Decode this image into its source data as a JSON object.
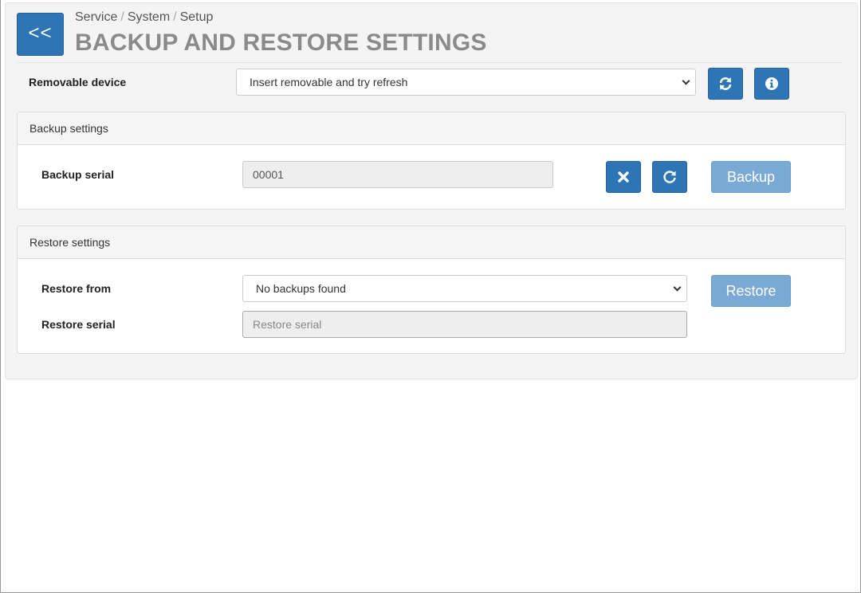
{
  "header": {
    "back_label": "<<",
    "breadcrumb": [
      "Service",
      "System",
      "Setup"
    ],
    "breadcrumb_sep": "/",
    "title": "BACKUP AND RESTORE SETTINGS"
  },
  "device": {
    "label": "Removable device",
    "selected": "Insert removable and try refresh",
    "refresh_icon": "refresh-icon",
    "info_icon": "info-icon"
  },
  "backup": {
    "heading": "Backup settings",
    "serial_label": "Backup serial",
    "serial_value": "00001",
    "clear_icon": "close-icon",
    "reset_icon": "reload-icon",
    "button_label": "Backup"
  },
  "restore": {
    "heading": "Restore settings",
    "from_label": "Restore from",
    "from_selected": "No backups found",
    "serial_label": "Restore serial",
    "serial_placeholder": "Restore serial",
    "button_label": "Restore"
  },
  "colors": {
    "primary": "#2e75b6",
    "primary_disabled": "#7aa9d6",
    "title": "#8a8a8a"
  }
}
